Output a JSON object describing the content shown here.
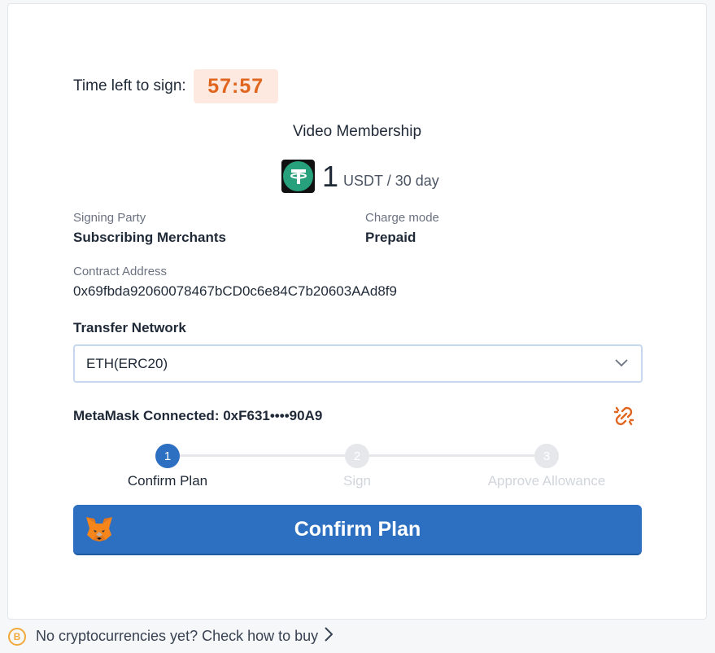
{
  "timer": {
    "label": "Time left to sign:",
    "value": "57:57"
  },
  "plan": {
    "title": "Video Membership",
    "amount": "1",
    "unit": "USDT / 30 day",
    "token_icon": "usdt-icon"
  },
  "details": {
    "signing_party_label": "Signing Party",
    "signing_party_value": "Subscribing Merchants",
    "charge_mode_label": "Charge mode",
    "charge_mode_value": "Prepaid",
    "contract_label": "Contract Address",
    "contract_value": "0x69fbda92060078467bCD0c6e84C7b20603AAd8f9"
  },
  "network": {
    "label": "Transfer Network",
    "selected": "ETH(ERC20)"
  },
  "wallet": {
    "connected_text": "MetaMask Connected: 0xF631••••90A9"
  },
  "steps": [
    {
      "number": "1",
      "label": "Confirm Plan",
      "active": true
    },
    {
      "number": "2",
      "label": "Sign",
      "active": false
    },
    {
      "number": "3",
      "label": "Approve Allowance",
      "active": false
    }
  ],
  "action": {
    "label": "Confirm Plan"
  },
  "footer": {
    "text": "No cryptocurrencies yet? Check how to buy"
  },
  "colors": {
    "accent": "#2d6fc1",
    "timer": "#e0661f",
    "timer_bg": "#fde9df",
    "usdt": "#26a17b",
    "coin": "#f2a93b"
  }
}
